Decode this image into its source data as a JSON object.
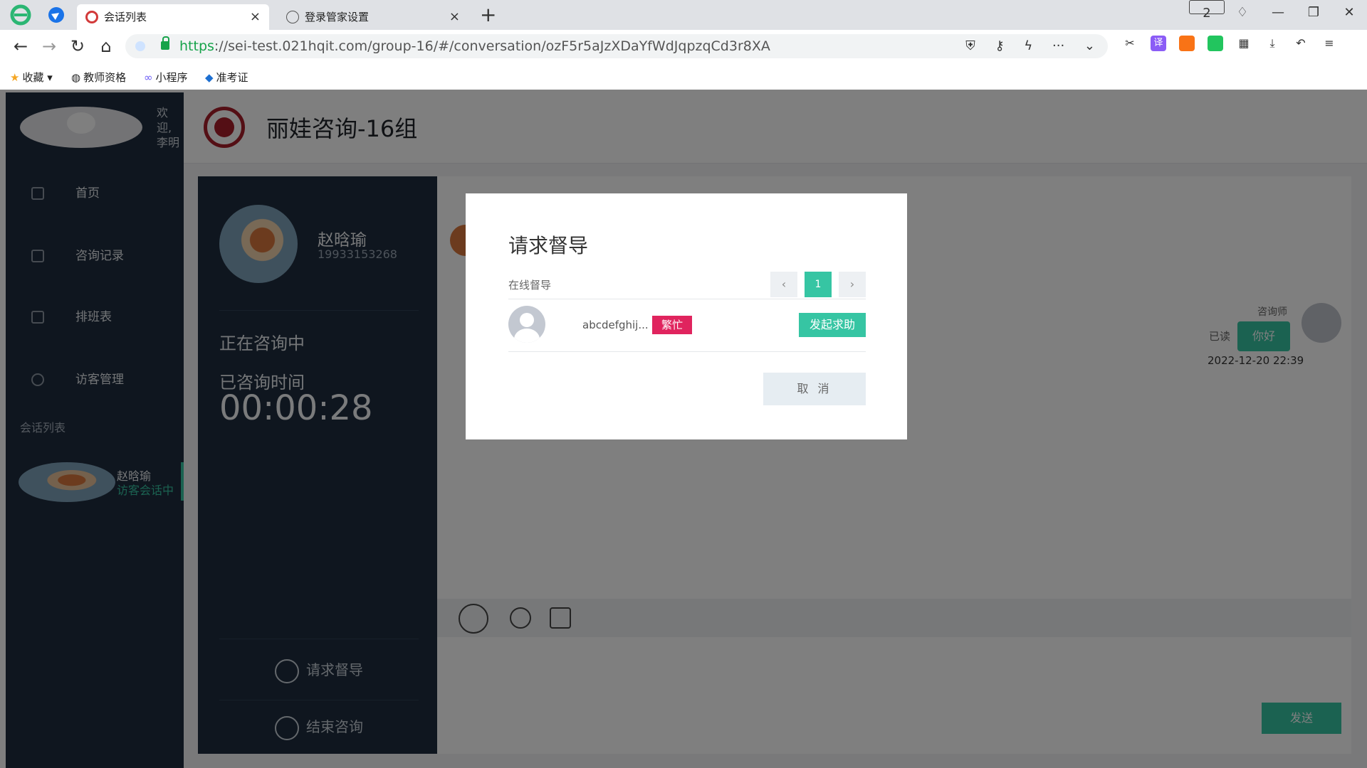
{
  "browser": {
    "tabs": [
      {
        "title": "会话列表",
        "close": "×"
      },
      {
        "title": "登录管家设置",
        "close": "×"
      }
    ],
    "new_tab": "+",
    "window_badge": "2",
    "url_scheme": "https",
    "url_rest": "://sei-test.021hqit.com/group-16/#/conversation/ozF5r5aJzXDaYfWdJqpzqCd3r8XA",
    "bookmarks": [
      "收藏",
      "教师资格",
      "小程序",
      "准考证"
    ]
  },
  "sidebar": {
    "welcome": "欢迎,李明",
    "items": [
      {
        "label": "首页"
      },
      {
        "label": "咨询记录"
      },
      {
        "label": "排班表"
      },
      {
        "label": "访客管理"
      }
    ],
    "section_title": "会话列表",
    "conversation": {
      "name": "赵晗瑜",
      "status": "访客会话中"
    }
  },
  "header": {
    "title": "丽娃咨询-16组"
  },
  "profile": {
    "name": "赵晗瑜",
    "phone": "19933153268",
    "status": "正在咨询中",
    "time_label": "已咨询时间",
    "time_value": "00:00:28",
    "actions": [
      {
        "label": "请求督导"
      },
      {
        "label": "结束咨询"
      }
    ]
  },
  "chat": {
    "agent_role": "咨询师",
    "read_label": "已读",
    "message": "你好",
    "message_time": "2022-12-20 22:39",
    "send_label": "发送"
  },
  "modal": {
    "title": "请求督导",
    "online_label": "在线督导",
    "pager": {
      "prev": "‹",
      "current": "1",
      "next": "›"
    },
    "supervisors": [
      {
        "name": "abcdefghij...",
        "status": "繁忙",
        "action": "发起求助"
      }
    ],
    "cancel_label": "取 消"
  },
  "colors": {
    "accent": "#36c5a3",
    "sidebar": "#1e2d3e",
    "busy": "#e0245e"
  }
}
